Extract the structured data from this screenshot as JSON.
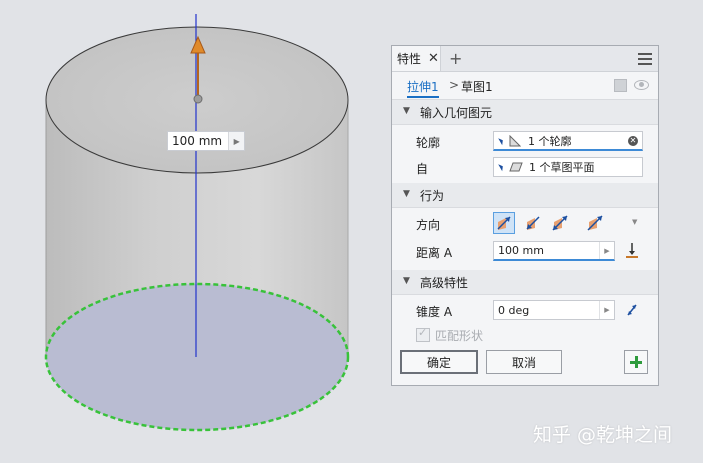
{
  "viewport": {
    "dimension_value": "100 mm"
  },
  "panel": {
    "tab_label": "特性",
    "tab_close": "✕",
    "add_tab": "+",
    "breadcrumb": {
      "feature": "拉伸1",
      "separator": ">",
      "sketch": "草图1"
    },
    "sections": {
      "input_geometry": "输入几何图元",
      "behavior": "行为",
      "advanced": "高级特性"
    },
    "profile": {
      "label": "轮廓",
      "value": "1 个轮廓"
    },
    "from": {
      "label": "自",
      "value": "1 个草图平面"
    },
    "direction": {
      "label": "方向"
    },
    "distance": {
      "label": "距离 A",
      "value": "100 mm"
    },
    "taper": {
      "label": "锥度 A",
      "value": "0 deg"
    },
    "match_shape": {
      "label": "匹配形状",
      "checked": true,
      "enabled": false
    },
    "buttons": {
      "ok": "确定",
      "cancel": "取消"
    }
  },
  "watermark": "知乎 @乾坤之间",
  "colors": {
    "accent": "#1a6fc4",
    "arrow": "#c8782a",
    "profile_edge": "#38c23a",
    "add_button": "#2e9b3c"
  }
}
